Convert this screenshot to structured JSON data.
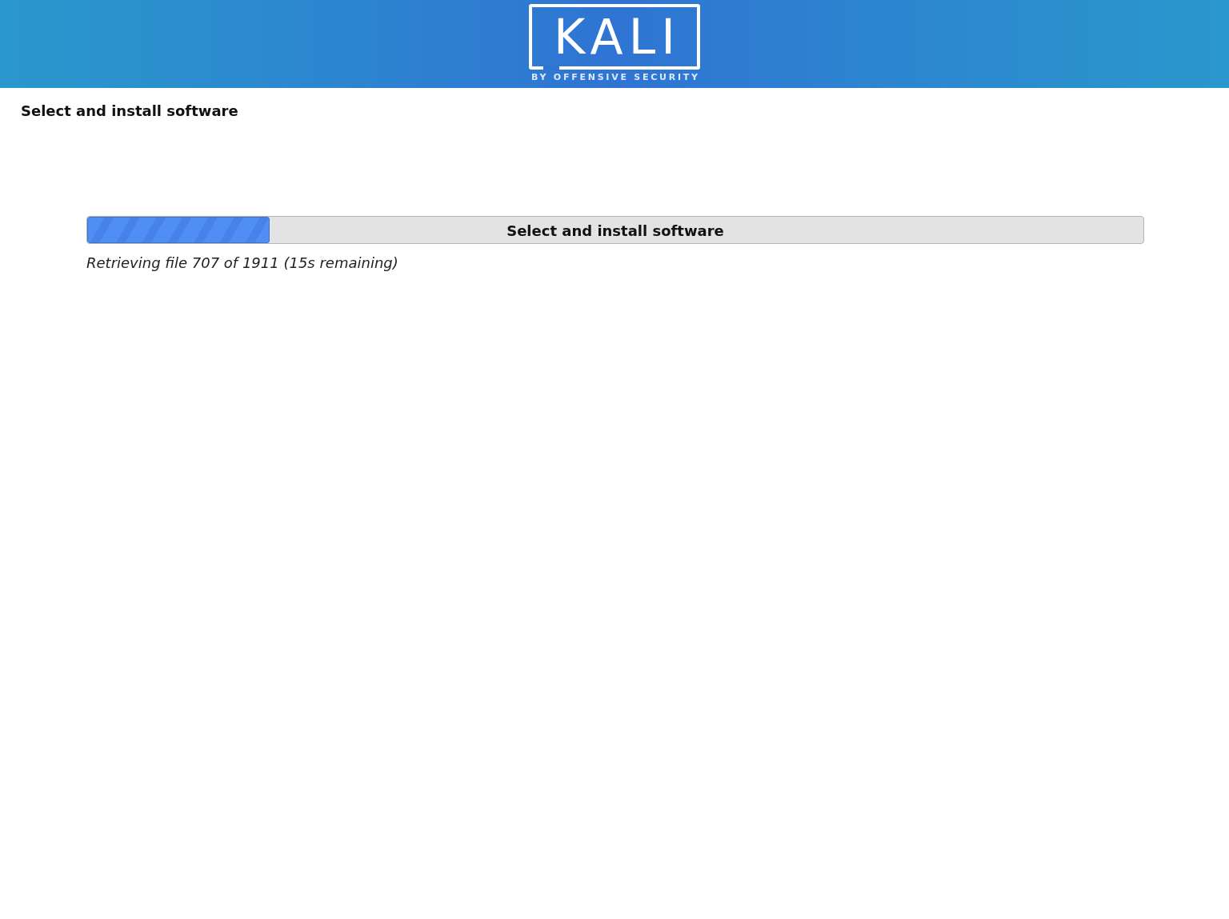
{
  "header": {
    "logo": {
      "wordmark": "KALI",
      "tagline": "BY OFFENSIVE SECURITY"
    }
  },
  "page_title": "Select and install software",
  "progress": {
    "label": "Select and install software",
    "level": 0.173,
    "status": "Retrieving file 707 of 1911 (15s remaining)"
  }
}
